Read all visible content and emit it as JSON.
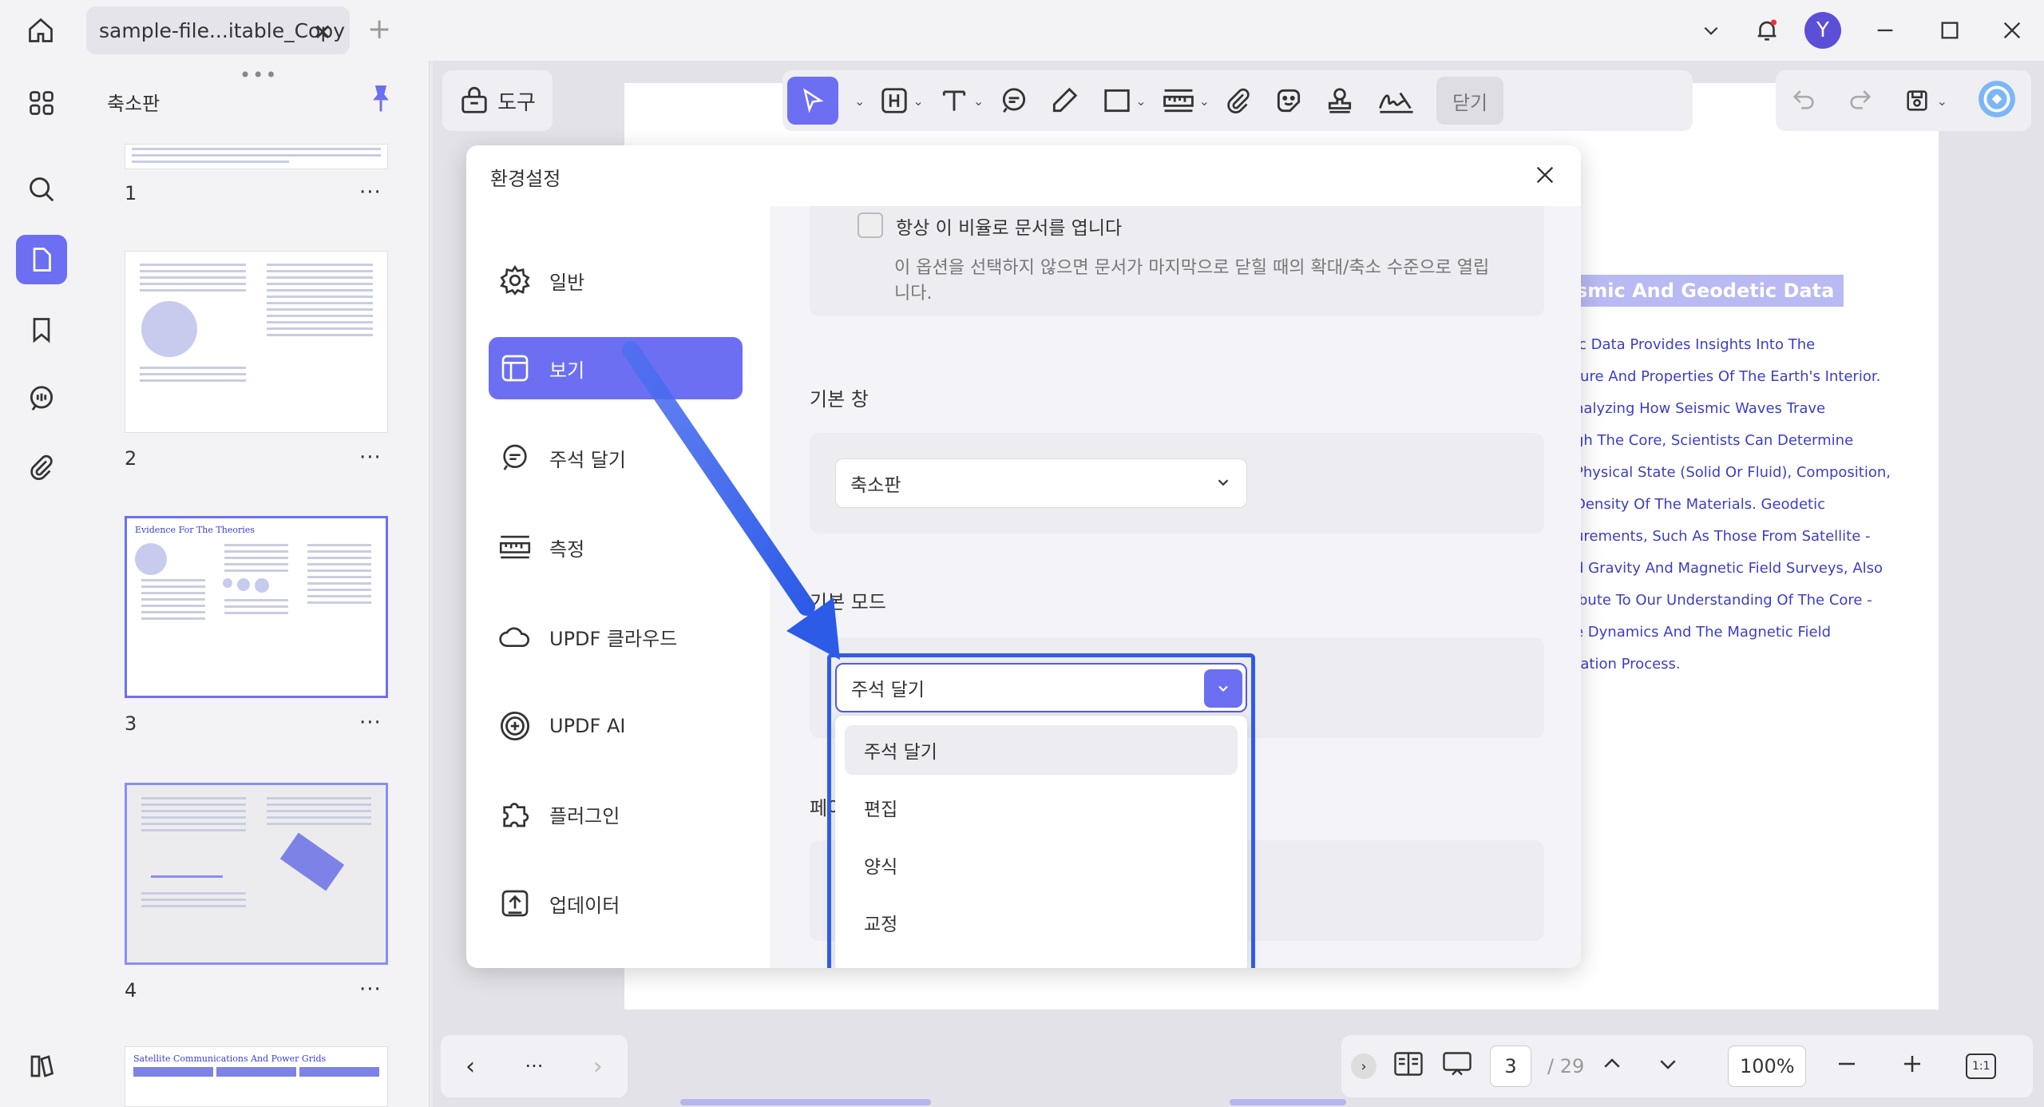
{
  "titlebar": {
    "tab_title": "sample-file...itable_Copy",
    "avatar_letter": "Y"
  },
  "thumbnails": {
    "header": "축소판",
    "pages": [
      {
        "num": "1",
        "title": ""
      },
      {
        "num": "2",
        "title": ""
      },
      {
        "num": "3",
        "title": "Evidence For The Theories"
      },
      {
        "num": "4",
        "title": ""
      },
      {
        "num": "",
        "title": "Satellite Communications And Power Grids"
      }
    ]
  },
  "toolbar": {
    "tools_label": "도구",
    "close_label": "닫기"
  },
  "document": {
    "heading": "smic And Geodetic Data",
    "lines": [
      "ic Data Provides Insights Into The",
      "ture And Properties Of The Earth's Interior.",
      "nalyzing How Seismic Waves Trave",
      "gh The Core, Scientists Can Determine",
      "Physical State (Solid Or Fluid), Composition,",
      "Density Of The Materials. Geodetic",
      "urements, Such As Those From Satellite -",
      "d Gravity And Magnetic Field Surveys, Also",
      "ibute To Our Understanding Of The Core -",
      "e Dynamics And The Magnetic Field",
      "ration Process."
    ]
  },
  "dialog": {
    "title": "환경설정",
    "nav": [
      {
        "label": "일반",
        "icon": "gear-icon"
      },
      {
        "label": "보기",
        "icon": "layout-icon"
      },
      {
        "label": "주석 달기",
        "icon": "comment-icon"
      },
      {
        "label": "측정",
        "icon": "ruler-icon"
      },
      {
        "label": "UPDF 클라우드",
        "icon": "cloud-icon"
      },
      {
        "label": "UPDF AI",
        "icon": "ai-icon"
      },
      {
        "label": "플러그인",
        "icon": "puzzle-icon"
      },
      {
        "label": "업데이터",
        "icon": "update-icon"
      }
    ],
    "checkbox_label": "항상 이 비율로 문서를 엽니다",
    "checkbox_desc": "이 옵션을 선택하지 않으면 문서가 마지막으로 닫힐 때의 확대/축소 수준으로 열립니다.",
    "default_pane_label": "기본 창",
    "default_pane_value": "축소판",
    "default_mode_label": "기본 모드",
    "default_mode_value": "주석 달기",
    "truncated_label": "페이",
    "mode_options": [
      "주석 달기",
      "편집",
      "양식",
      "교정"
    ]
  },
  "bottombar": {
    "ellipsis": "···",
    "page_current": "3",
    "page_total": "/ 29",
    "zoom": "100%",
    "fit_label": "1:1"
  },
  "colors": {
    "accent": "#6c6ff2",
    "highlight": "#2f5ce6"
  }
}
